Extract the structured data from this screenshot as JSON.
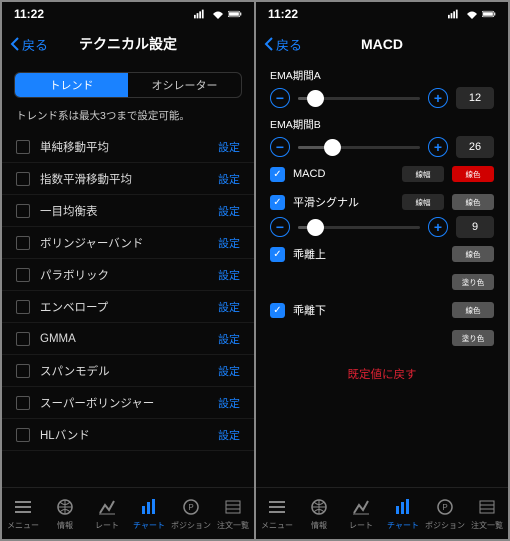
{
  "status": {
    "time": "11:22"
  },
  "left": {
    "back": "戻る",
    "title": "テクニカル設定",
    "tabs": [
      "トレンド",
      "オシレーター"
    ],
    "note": "トレンド系は最大3つまで設定可能。",
    "items": [
      {
        "label": "単純移動平均",
        "action": "設定"
      },
      {
        "label": "指数平滑移動平均",
        "action": "設定"
      },
      {
        "label": "一目均衡表",
        "action": "設定"
      },
      {
        "label": "ボリンジャーバンド",
        "action": "設定"
      },
      {
        "label": "パラボリック",
        "action": "設定"
      },
      {
        "label": "エンベロープ",
        "action": "設定"
      },
      {
        "label": "GMMA",
        "action": "設定"
      },
      {
        "label": "スパンモデル",
        "action": "設定"
      },
      {
        "label": "スーパーボリンジャー",
        "action": "設定"
      },
      {
        "label": "HLバンド",
        "action": "設定"
      }
    ]
  },
  "right": {
    "back": "戻る",
    "title": "MACD",
    "params": [
      {
        "label": "EMA期間A",
        "value": "12",
        "pos": 14
      },
      {
        "label": "EMA期間B",
        "value": "26",
        "pos": 28
      }
    ],
    "checks": [
      {
        "label": "MACD",
        "swatches": [
          {
            "text": "線幅",
            "bg": "#2a2a2a"
          },
          {
            "text": "線色",
            "bg": "#d00000"
          }
        ]
      },
      {
        "label": "平滑シグナル",
        "swatches": [
          {
            "text": "線幅",
            "bg": "#2a2a2a"
          },
          {
            "text": "線色",
            "bg": "#555"
          }
        ],
        "slider": {
          "value": "9",
          "pos": 14
        }
      },
      {
        "label": "乖離上",
        "swatches": [
          {
            "text": "線色",
            "bg": "#555"
          },
          {
            "text": "塗り色",
            "bg": "#555"
          }
        ],
        "stacked": true
      },
      {
        "label": "乖離下",
        "swatches": [
          {
            "text": "線色",
            "bg": "#555"
          },
          {
            "text": "塗り色",
            "bg": "#555"
          }
        ],
        "stacked": true
      }
    ],
    "reset": "既定値に戻す"
  },
  "tabbar": [
    {
      "label": "メニュー"
    },
    {
      "label": "情報"
    },
    {
      "label": "レート"
    },
    {
      "label": "チャート",
      "active": true
    },
    {
      "label": "ポジション"
    },
    {
      "label": "注文一覧"
    }
  ]
}
